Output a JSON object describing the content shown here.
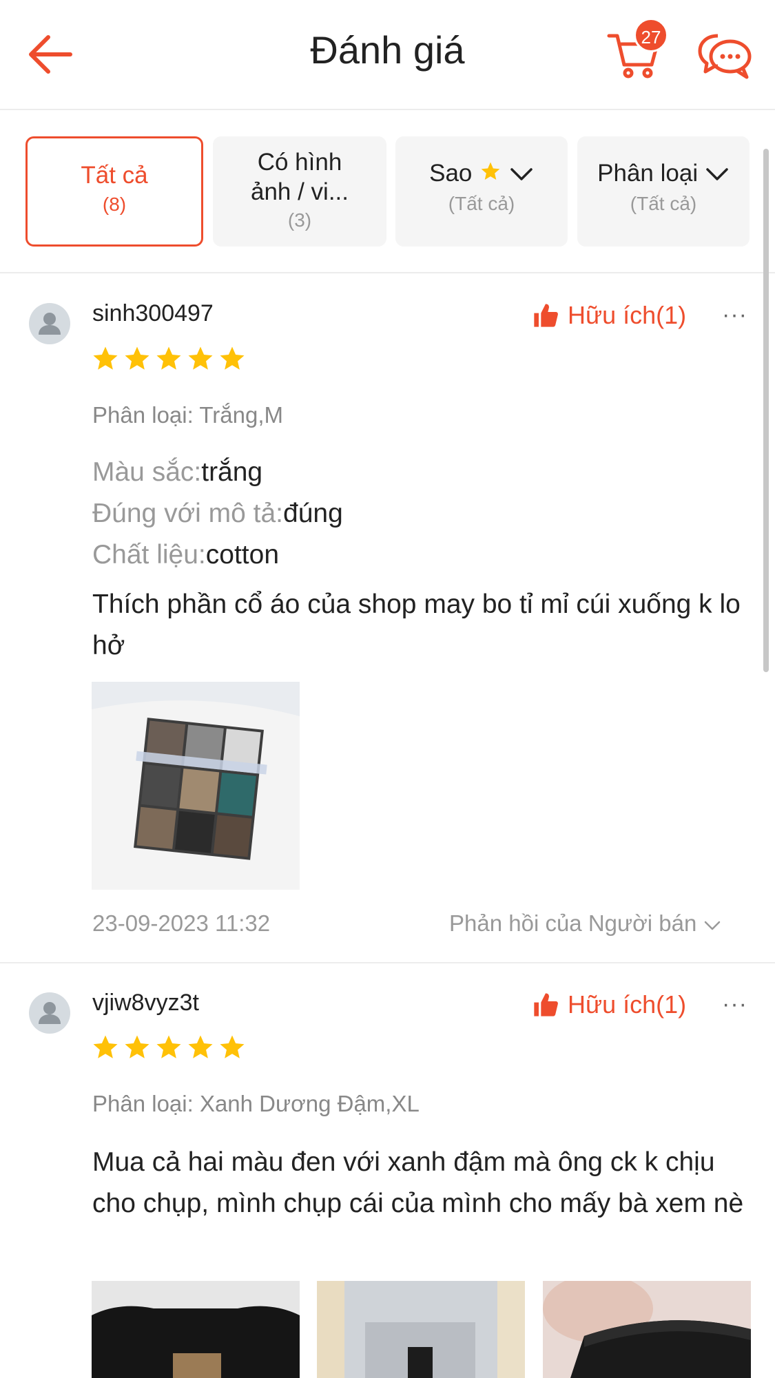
{
  "header": {
    "title": "Đánh giá",
    "cart_count": "27",
    "icons": {
      "back": "back-arrow-icon",
      "cart": "cart-icon",
      "chat": "chat-icon"
    }
  },
  "filters": [
    {
      "label": "Tất cả",
      "sub": "(8)",
      "active": true
    },
    {
      "label_line1": "Có hình",
      "label_line2": "ảnh / vi...",
      "sub": "(3)",
      "active": false
    },
    {
      "label": "Sao",
      "sub": "(Tất cả)",
      "active": false
    },
    {
      "label": "Phân loại",
      "sub": "(Tất cả)",
      "active": false
    }
  ],
  "colors": {
    "accent": "#ee4d2d",
    "star": "#ffc107",
    "muted": "#999999"
  },
  "reviews": [
    {
      "username": "sinh300497",
      "rating": 5,
      "helpful": "Hữu ích(1)",
      "more": "···",
      "variant": "Phân loại: Trắng,M",
      "attributes": [
        {
          "key": "Màu sắc:",
          "value": "trắng"
        },
        {
          "key": "Đúng với mô tả:",
          "value": "đúng"
        },
        {
          "key": "Chất liệu:",
          "value": "cotton"
        }
      ],
      "comment": "Thích phần cổ áo của shop may bo tỉ mỉ cúi xuống k lo hở",
      "date": "23-09-2023 11:32",
      "seller_reply": "Phản hồi của Người bán"
    },
    {
      "username": "vjiw8vyz3t",
      "rating": 5,
      "helpful": "Hữu ích(1)",
      "more": "···",
      "variant": "Phân loại: Xanh Dương Đậm,XL",
      "comment": "Mua cả hai màu đen với xanh đậm mà ông ck k chịu cho chụp, mình chụp cái của mình cho mấy bà xem nè"
    }
  ]
}
